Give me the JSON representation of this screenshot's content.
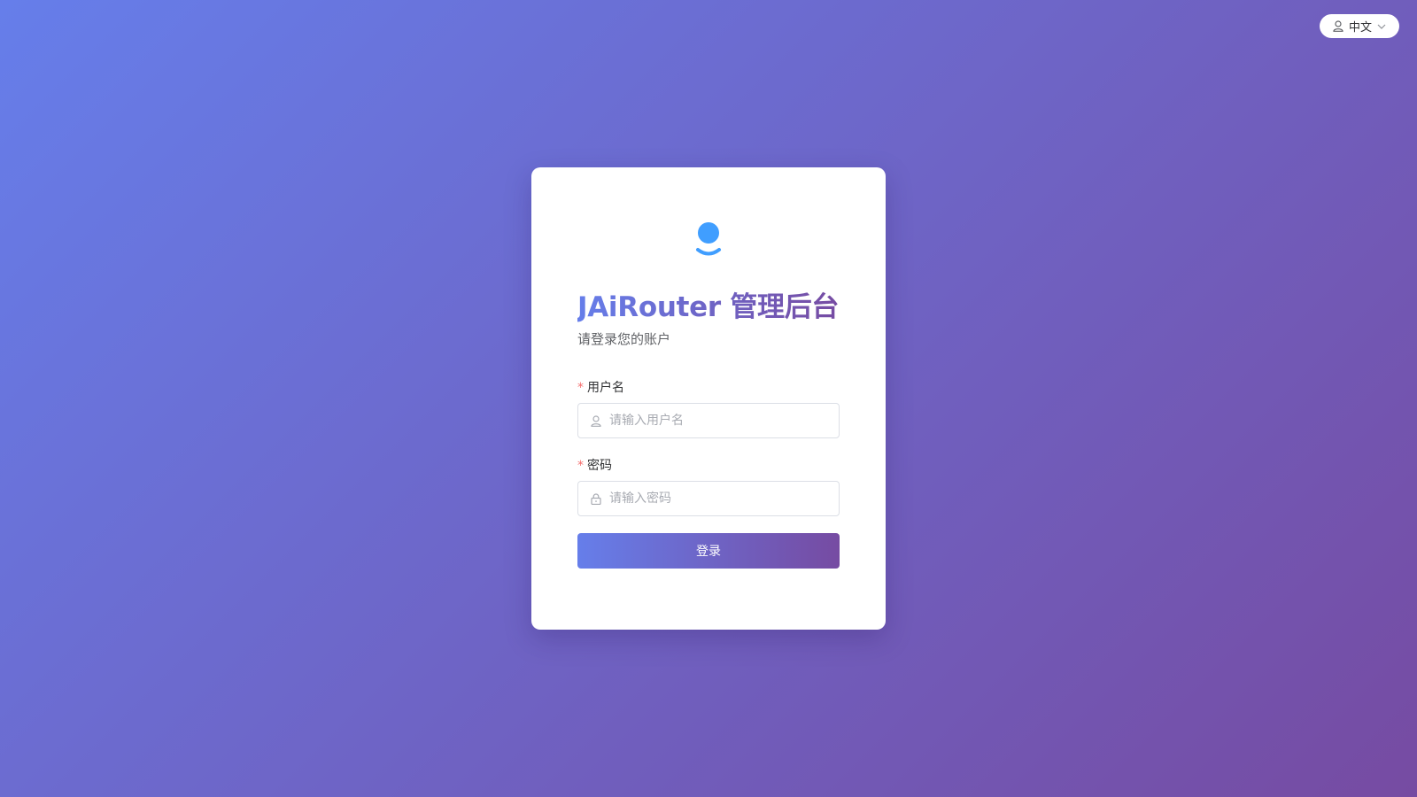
{
  "lang_switch": {
    "label": "中文",
    "icon": "user-icon",
    "chevron": "chevron-down-icon"
  },
  "card": {
    "logo_icon": "user-logo-icon",
    "title": "JAiRouter 管理后台",
    "subtitle": "请登录您的账户"
  },
  "form": {
    "required_mark": "*",
    "username": {
      "label": "用户名",
      "placeholder": "请输入用户名",
      "icon": "user-icon",
      "value": ""
    },
    "password": {
      "label": "密码",
      "placeholder": "请输入密码",
      "icon": "lock-icon",
      "value": ""
    },
    "submit_label": "登录"
  },
  "colors": {
    "gradient_start": "#667eea",
    "gradient_end": "#764ba2",
    "logo_blue": "#409eff",
    "required_red": "#f56c6c"
  }
}
